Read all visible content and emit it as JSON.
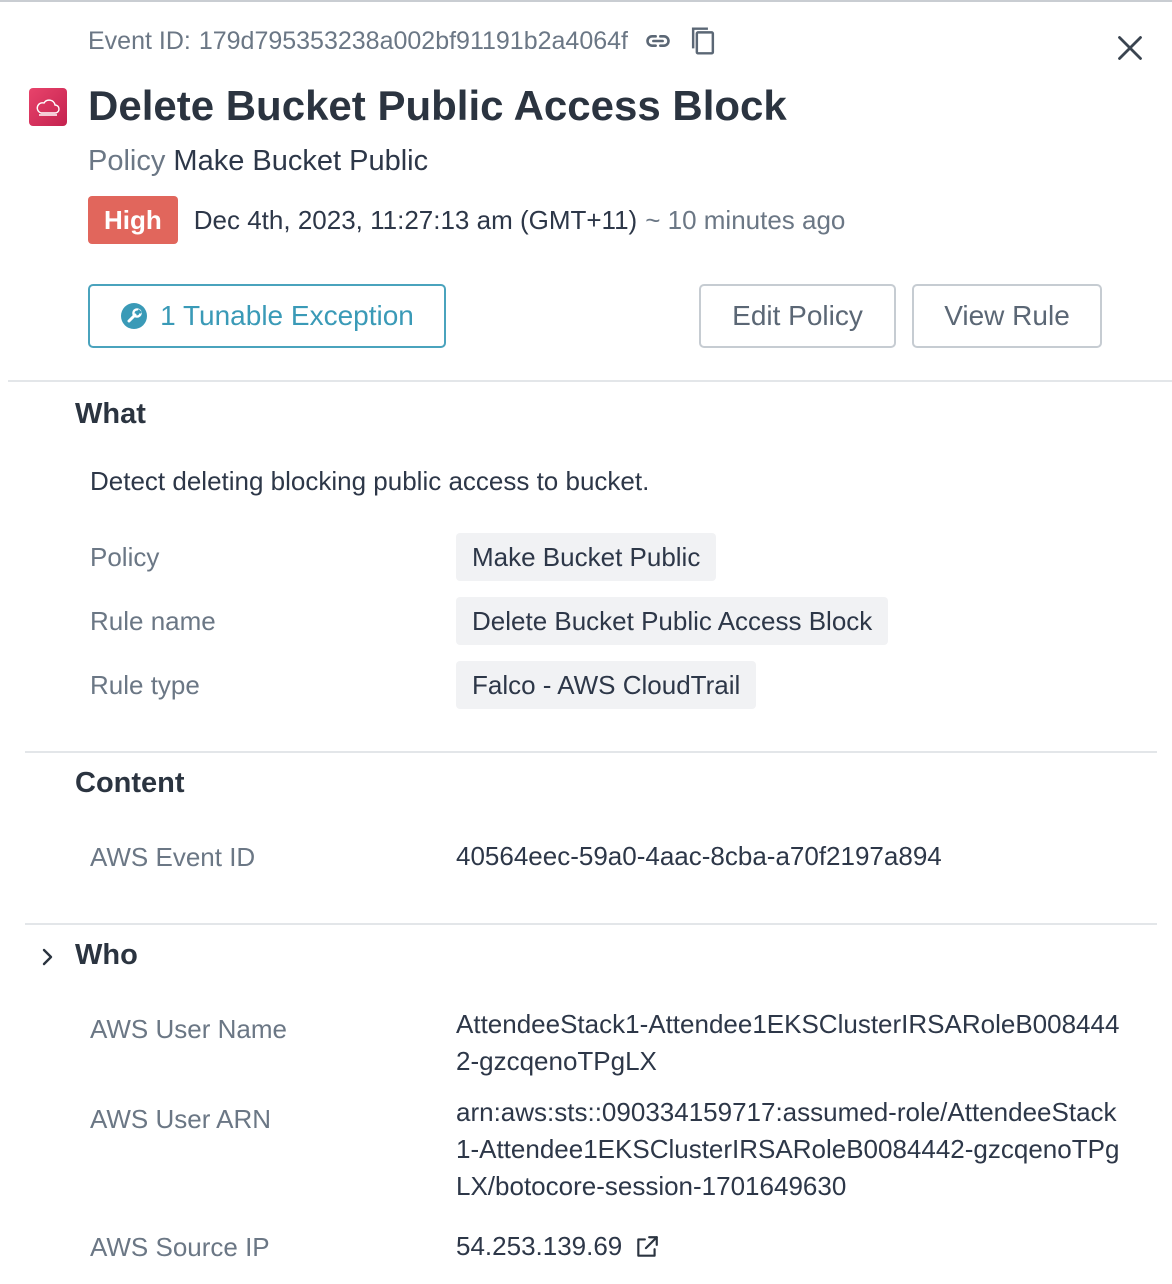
{
  "header": {
    "event_id_label": "Event ID:",
    "event_id": "179d795353238a002bf91191b2a4064f",
    "title": "Delete Bucket Public Access Block",
    "policy_label": "Policy",
    "policy_name": "Make Bucket Public",
    "severity": "High",
    "timestamp": "Dec 4th, 2023, 11:27:13 am (GMT+11)",
    "relative_time": "~ 10 minutes ago"
  },
  "actions": {
    "exception_label": "1 Tunable Exception",
    "edit_policy_label": "Edit Policy",
    "view_rule_label": "View Rule"
  },
  "what": {
    "title": "What",
    "description": "Detect deleting blocking public access to bucket.",
    "rows": [
      {
        "label": "Policy",
        "value": "Make Bucket Public"
      },
      {
        "label": "Rule name",
        "value": "Delete Bucket Public Access Block"
      },
      {
        "label": "Rule type",
        "value": "Falco - AWS CloudTrail"
      }
    ]
  },
  "content": {
    "title": "Content",
    "rows": [
      {
        "label": "AWS Event ID",
        "value": "40564eec-59a0-4aac-8cba-a70f2197a894"
      }
    ]
  },
  "who": {
    "title": "Who",
    "rows": [
      {
        "label": "AWS User Name",
        "value": "AttendeeStack1-Attendee1EKSClusterIRSARoleB0084442-gzcqenoTPgLX"
      },
      {
        "label": "AWS User ARN",
        "value": "arn:aws:sts::090334159717:assumed-role/AttendeeStack1-Attendee1EKSClusterIRSARoleB0084442-gzcqenoTPgLX/botocore-session-1701649630"
      },
      {
        "label": "AWS Source IP",
        "value": "54.253.139.69"
      }
    ]
  },
  "icons": {
    "link": "link-icon",
    "copy": "copy-icon",
    "close": "close-icon",
    "app": "aws-cloud-icon",
    "wrench": "wrench-icon",
    "chevron": "chevron-right-icon",
    "external": "external-link-icon"
  },
  "colors": {
    "severity_high": "#e1665c",
    "accent": "#3a9ab7",
    "app_icon": "#d6305a"
  }
}
